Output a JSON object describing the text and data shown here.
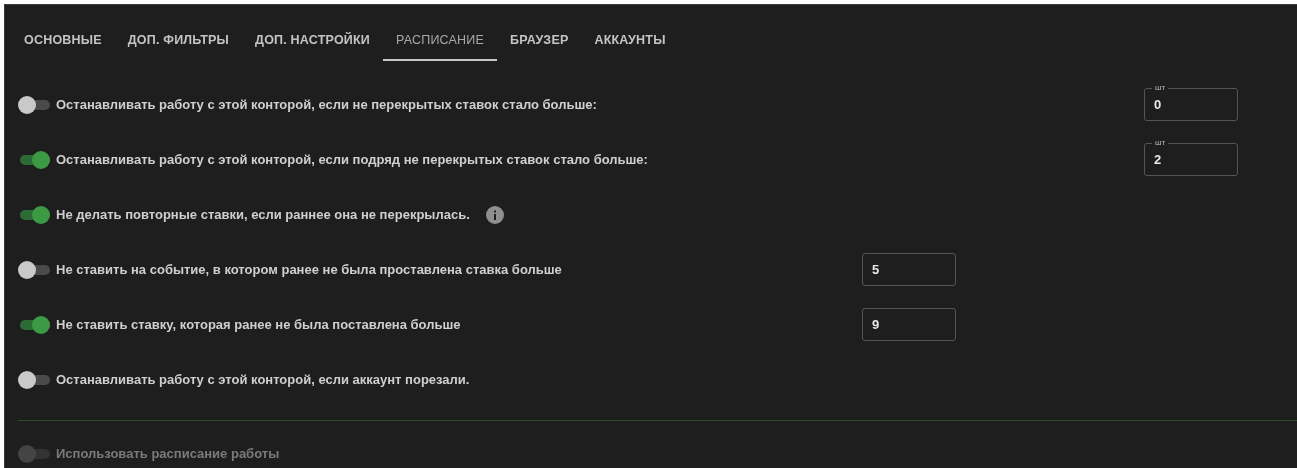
{
  "tabs": [
    {
      "label": "ОСНОВНЫЕ",
      "selected": false
    },
    {
      "label": "ДОП. ФИЛЬТРЫ",
      "selected": false
    },
    {
      "label": "ДОП. НАСТРОЙКИ",
      "selected": false
    },
    {
      "label": "РАСПИСАНИЕ",
      "selected": true
    },
    {
      "label": "БРАУЗЕР",
      "selected": false
    },
    {
      "label": "АККАУНТЫ",
      "selected": false
    }
  ],
  "settings": [
    {
      "label": "Останавливать работу с этой конторой, если не перекрытых ставок стало больше:",
      "on": false,
      "field": {
        "kind": "counter",
        "label": "шт",
        "value": "0"
      }
    },
    {
      "label": "Останавливать работу с этой конторой, если подряд не перекрытых ставок стало больше:",
      "on": true,
      "field": {
        "kind": "counter",
        "label": "шт",
        "value": "2"
      }
    },
    {
      "label": "Не делать повторные ставки, если раннее она не перекрылась.",
      "on": true,
      "info": true
    },
    {
      "label": "Не ставить на событие, в котором ранее не была проставлена ставка больше",
      "on": false,
      "field": {
        "kind": "number",
        "value": "5"
      }
    },
    {
      "label": "Не ставить ставку, которая ранее не была поставлена больше",
      "on": true,
      "field": {
        "kind": "number",
        "value": "9"
      }
    },
    {
      "label": "Останавливать работу с этой конторой, если аккаунт порезали.",
      "on": false
    }
  ],
  "schedule": {
    "label": "Использовать расписание работы",
    "on": false,
    "disabled": true
  }
}
